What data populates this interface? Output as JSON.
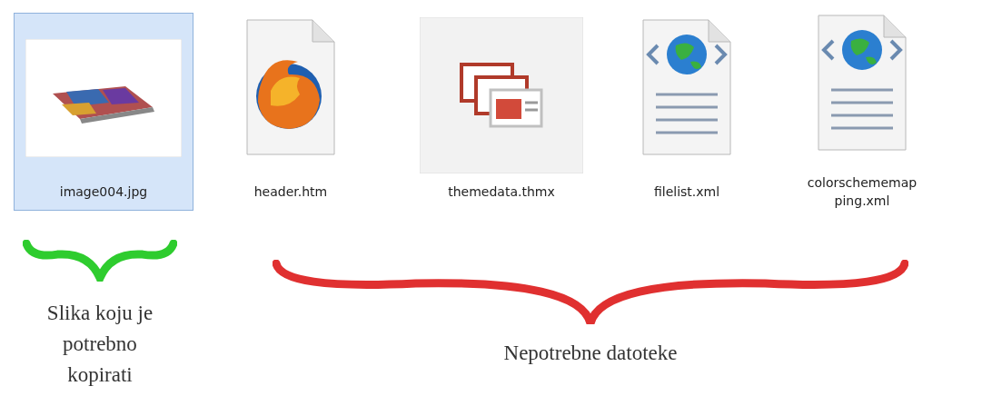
{
  "files": [
    {
      "name": "image004.jpg",
      "kind": "image",
      "selected": true
    },
    {
      "name": "header.htm",
      "kind": "browser",
      "selected": false
    },
    {
      "name": "themedata.thmx",
      "kind": "theme",
      "selected": false
    },
    {
      "name": "filelist.xml",
      "kind": "xml",
      "selected": false
    },
    {
      "name": "colorschememapping.xml",
      "kind": "xml",
      "selected": false
    }
  ],
  "annotations": [
    {
      "text": "Slika koju je potrebno kopirati",
      "color": "#2ecc2e"
    },
    {
      "text": "Nepotrebne datoteke",
      "color": "#e03030"
    }
  ]
}
